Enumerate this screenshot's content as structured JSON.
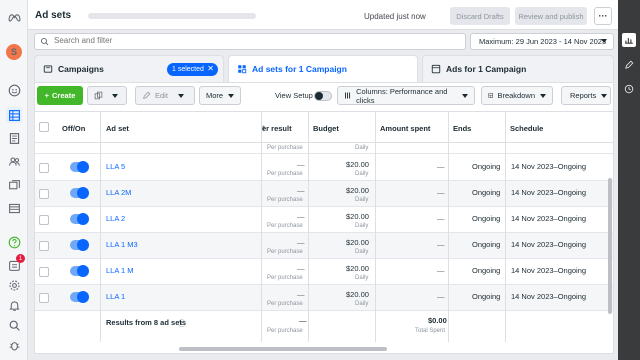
{
  "header": {
    "title": "Ad sets",
    "updated": "Updated just now",
    "discard_label": "Discard Drafts",
    "review_label": "Review and publish"
  },
  "search": {
    "placeholder": "Search and filter"
  },
  "date_range": "Maximum: 29 Jun 2023 - 14 Nov 2023",
  "tabs": [
    {
      "label": "Campaigns",
      "selected_pill": "1 selected"
    },
    {
      "label": "Ad sets for 1 Campaign"
    },
    {
      "label": "Ads for 1 Campaign"
    }
  ],
  "toolbar": {
    "create": "Create",
    "edit": "Edit",
    "more": "More",
    "view_setup": "View Setup",
    "columns": "Columns: Performance and clicks",
    "breakdown": "Breakdown",
    "reports": "Reports"
  },
  "columns": {
    "off_on": "Off/On",
    "ad_set": "Ad set",
    "result": "er result",
    "budget": "Budget",
    "amount_spent": "Amount spent",
    "ends": "Ends",
    "schedule": "Schedule"
  },
  "partial_row": {
    "per": "Per purchase",
    "daily": "Daily"
  },
  "rows": [
    {
      "name": "LLA 5",
      "result": "—",
      "per": "Per purchase",
      "budget": "$20.00",
      "daily": "Daily",
      "spent": "—",
      "ends": "Ongoing",
      "schedule": "14 Nov 2023–Ongoing"
    },
    {
      "name": "LLA 2M",
      "result": "—",
      "per": "Per purchase",
      "budget": "$20.00",
      "daily": "Daily",
      "spent": "—",
      "ends": "Ongoing",
      "schedule": "14 Nov 2023–Ongoing"
    },
    {
      "name": "LLA 2",
      "result": "—",
      "per": "Per purchase",
      "budget": "$20.00",
      "daily": "Daily",
      "spent": "—",
      "ends": "Ongoing",
      "schedule": "14 Nov 2023–Ongoing"
    },
    {
      "name": "LLA 1 M3",
      "result": "—",
      "per": "Per purchase",
      "budget": "$20.00",
      "daily": "Daily",
      "spent": "—",
      "ends": "Ongoing",
      "schedule": "14 Nov 2023–Ongoing"
    },
    {
      "name": "LLA 1 M",
      "result": "—",
      "per": "Per purchase",
      "budget": "$20.00",
      "daily": "Daily",
      "spent": "—",
      "ends": "Ongoing",
      "schedule": "14 Nov 2023–Ongoing"
    },
    {
      "name": "LLA 1",
      "result": "—",
      "per": "Per purchase",
      "budget": "$20.00",
      "daily": "Daily",
      "spent": "—",
      "ends": "Ongoing",
      "schedule": "14 Nov 2023–Ongoing"
    }
  ],
  "summary": {
    "label": "Results from 8 ad sets",
    "result": "—",
    "per": "Per purchase",
    "spent": "$0.00",
    "spent_sub": "Total Spent"
  },
  "rail": {
    "avatar": "S",
    "notification_count": "1"
  },
  "colors": {
    "accent": "#0866ff",
    "create": "#42b72a"
  }
}
